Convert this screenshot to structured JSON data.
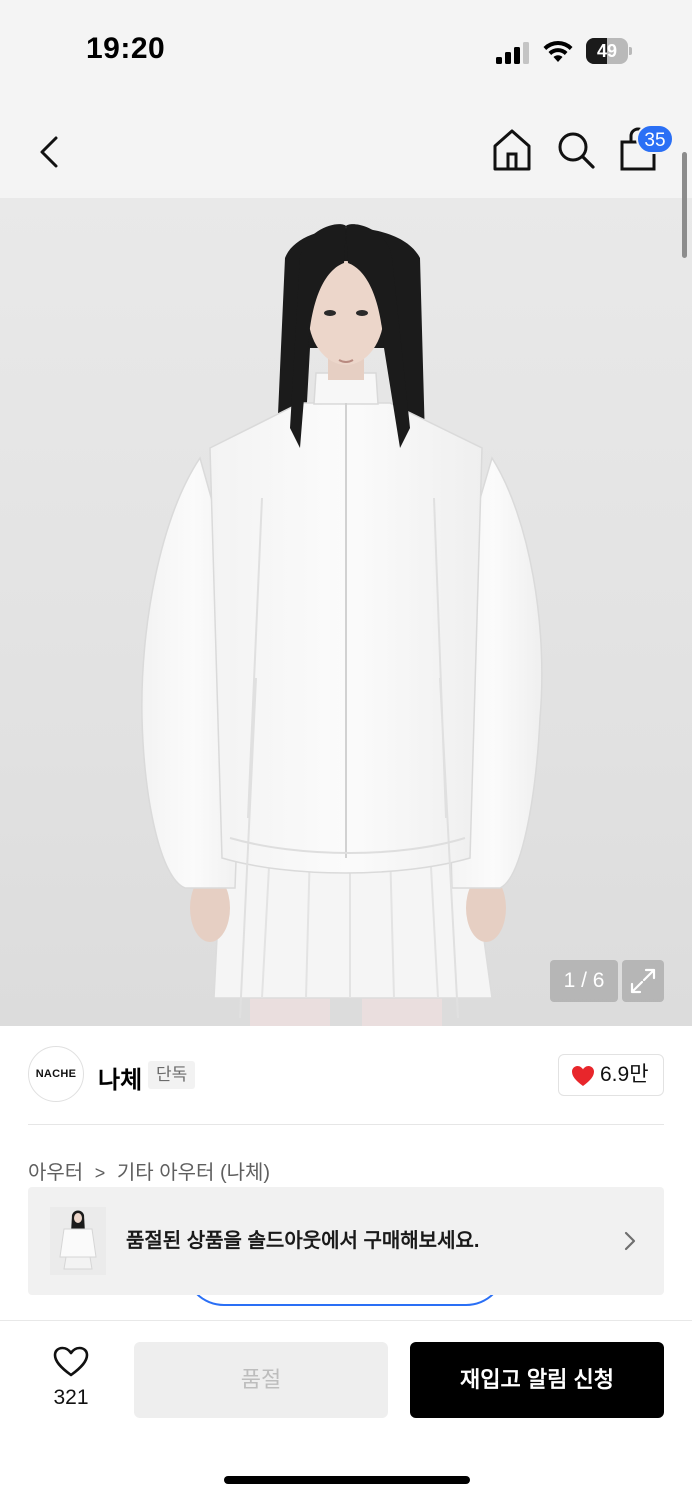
{
  "status_bar": {
    "time": "19:20",
    "battery": "49",
    "battery_level": 0.49
  },
  "nav": {
    "back_icon": "chevron-left-icon",
    "home_icon": "home-icon",
    "search_icon": "search-icon",
    "cart_icon": "shopping-bag-icon",
    "cart_badge": "35",
    "badge_color": "#2a6ff5"
  },
  "gallery": {
    "counter": "1 / 6",
    "expand_icon": "expand-icon"
  },
  "brand": {
    "logo_text": "NACHE",
    "name": "나체",
    "tag": "단독",
    "like_count": "6.9만",
    "like_icon": "heart-filled-icon",
    "like_color": "#e8262b"
  },
  "breadcrumb": {
    "level1": "아우터",
    "separator": ">",
    "level2": "기타 아우터 (나체)"
  },
  "soldout_banner": {
    "text": "품절된 상품을 솔드아웃에서 구매해보세요.",
    "chevron_icon": "chevron-right-icon"
  },
  "bottom_bar": {
    "wish_icon": "heart-outline-icon",
    "wish_count": "321",
    "soldout_label": "품절",
    "restock_label": "재입고 알림 신청"
  }
}
